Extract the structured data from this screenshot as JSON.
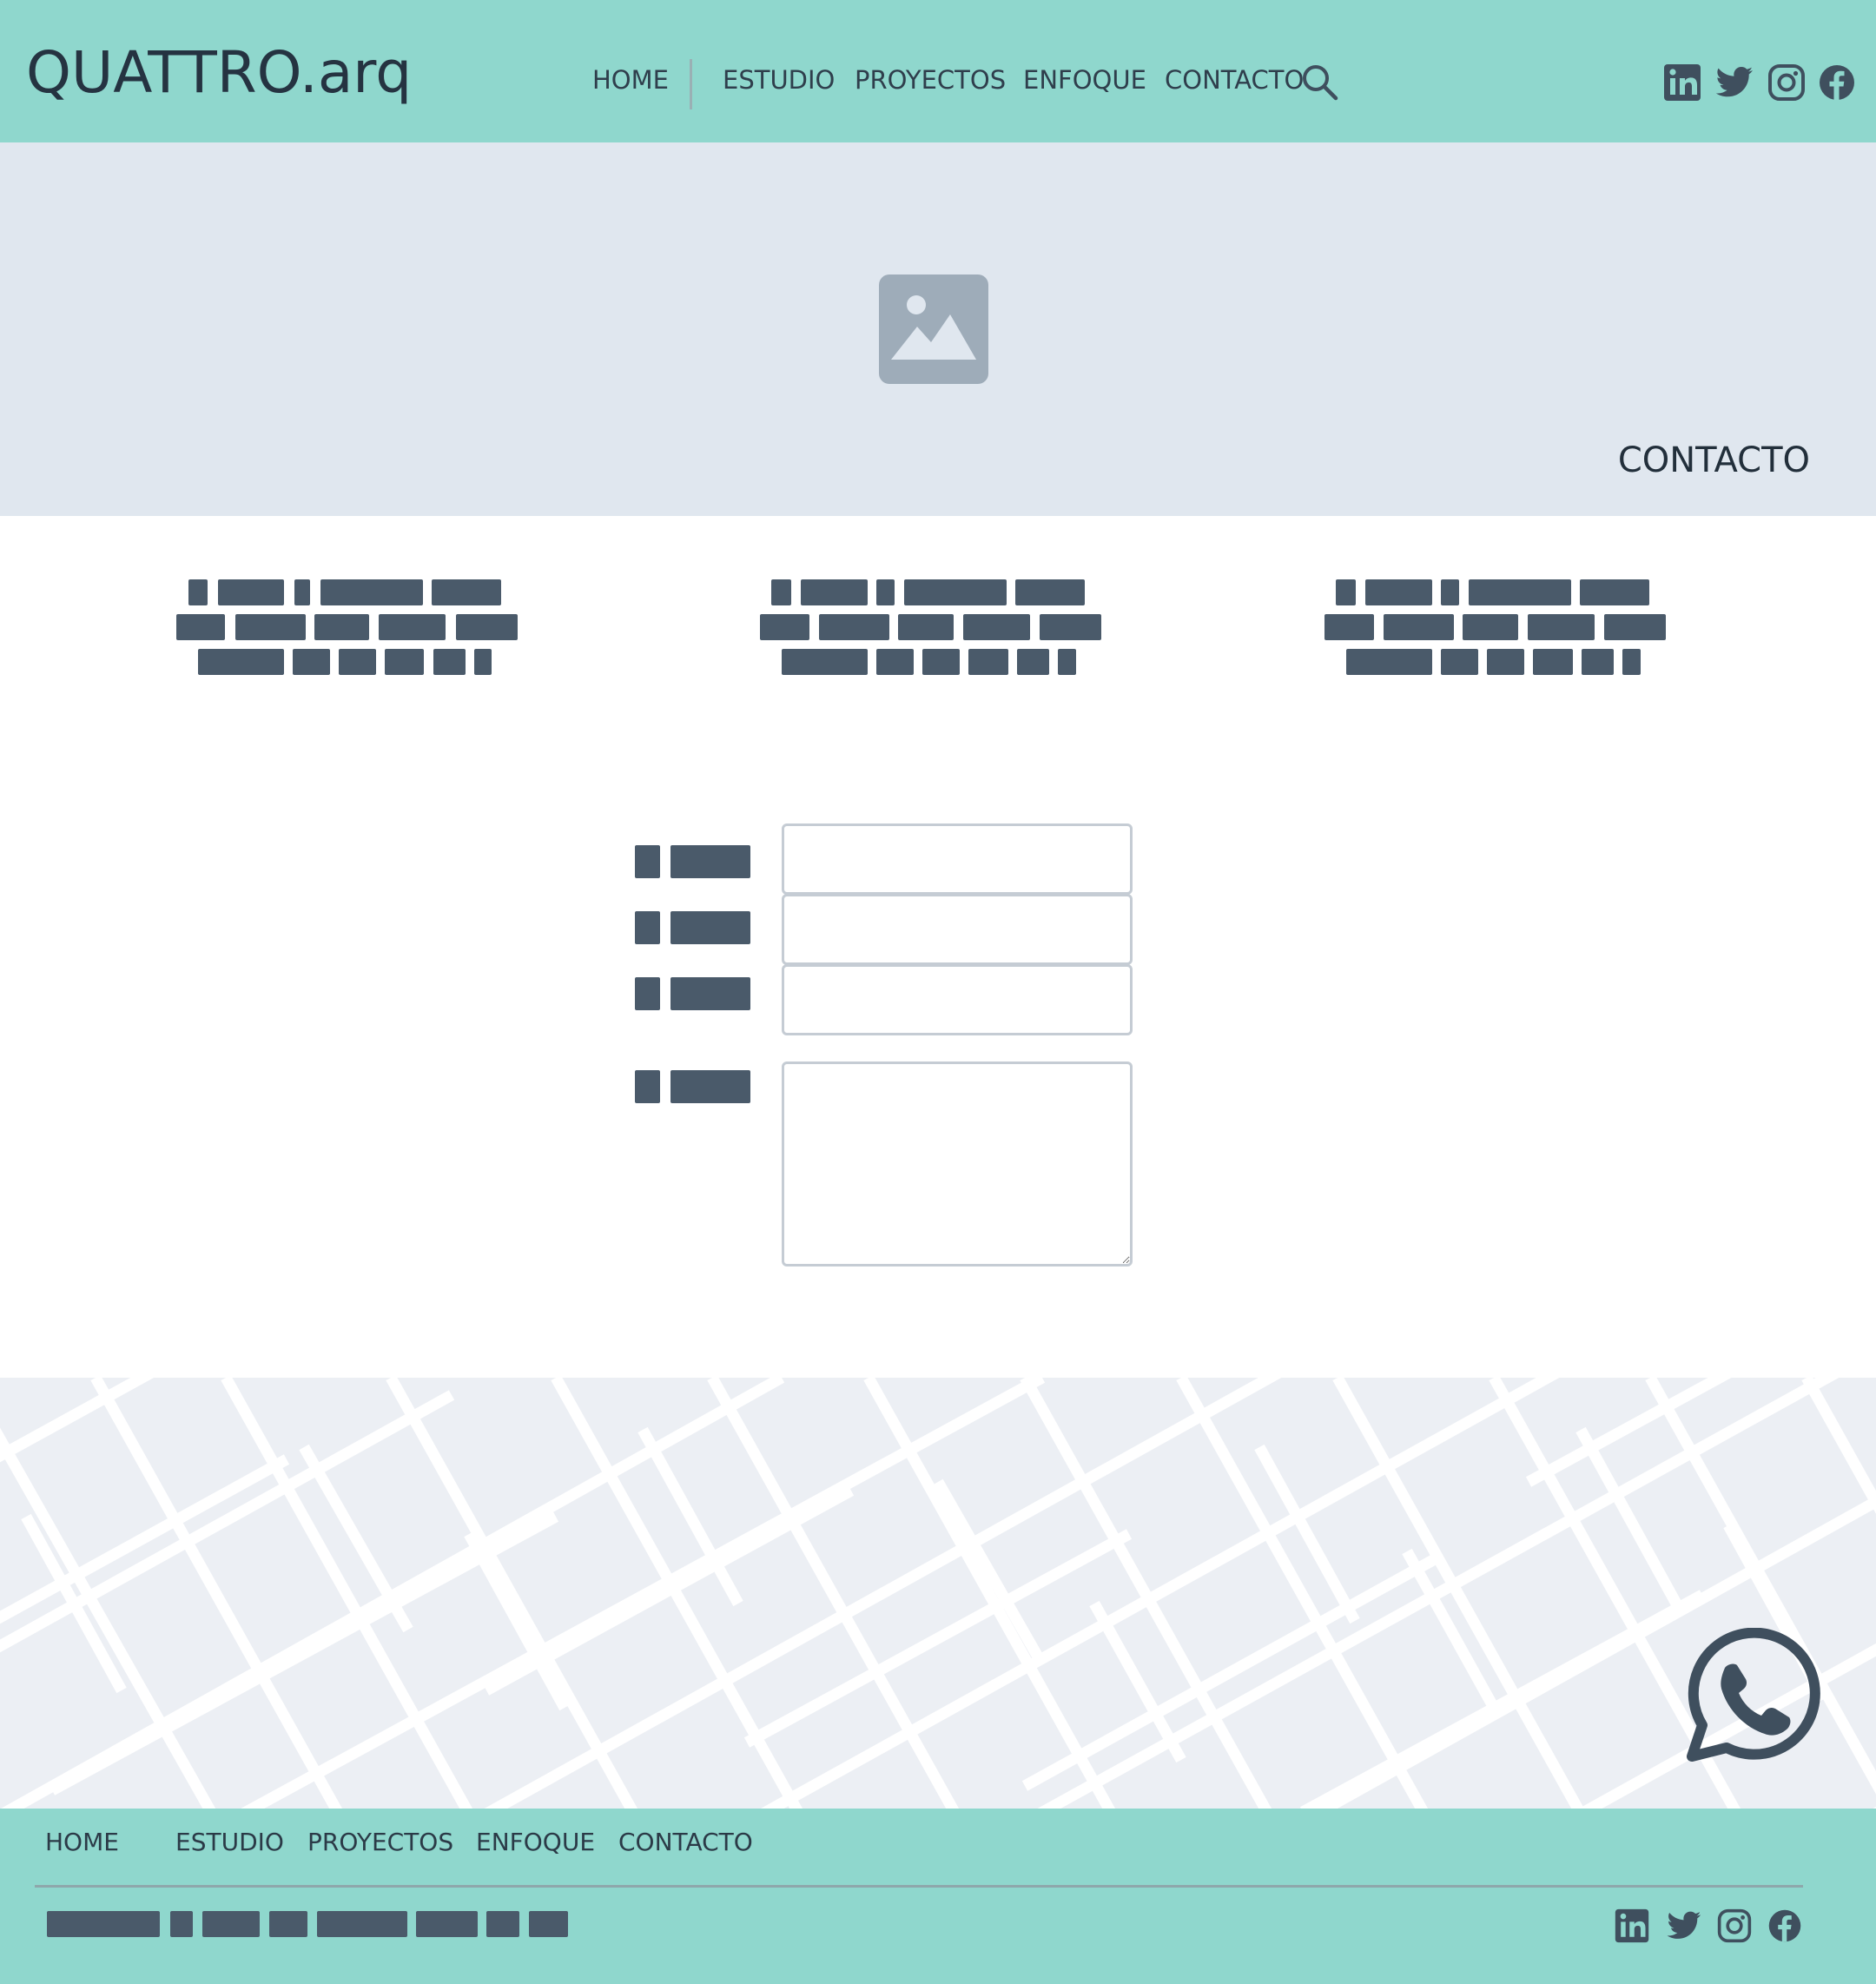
{
  "header": {
    "logo": "QUATTRO.arq",
    "nav": [
      {
        "label": "HOME"
      },
      {
        "label": "ESTUDIO"
      },
      {
        "label": "PROYECTOS"
      },
      {
        "label": "ENFOQUE"
      },
      {
        "label": "CONTACTO"
      }
    ],
    "search_icon": "search-icon",
    "social_icons": [
      "linkedin-icon",
      "twitter-icon",
      "instagram-icon",
      "facebook-icon"
    ]
  },
  "hero": {
    "image_icon": "image-placeholder-icon",
    "title": "CONTACTO"
  },
  "form": {
    "fields": [
      {
        "name": "field-1",
        "value": ""
      },
      {
        "name": "field-2",
        "value": ""
      },
      {
        "name": "field-3",
        "value": ""
      },
      {
        "name": "message",
        "value": ""
      }
    ]
  },
  "floating": {
    "icon": "whatsapp-icon"
  },
  "footer": {
    "nav": [
      {
        "label": "HOME"
      },
      {
        "label": "ESTUDIO"
      },
      {
        "label": "PROYECTOS"
      },
      {
        "label": "ENFOQUE"
      },
      {
        "label": "CONTACTO"
      }
    ],
    "social_icons": [
      "linkedin-icon",
      "twitter-icon",
      "instagram-icon",
      "facebook-icon"
    ]
  },
  "colors": {
    "header_bg": "#8fd7cd",
    "hero_bg": "#e0e7ef",
    "map_bg": "#eceff4",
    "text_dark": "#2d3a46",
    "placeholder_block": "#4a5a6a"
  }
}
